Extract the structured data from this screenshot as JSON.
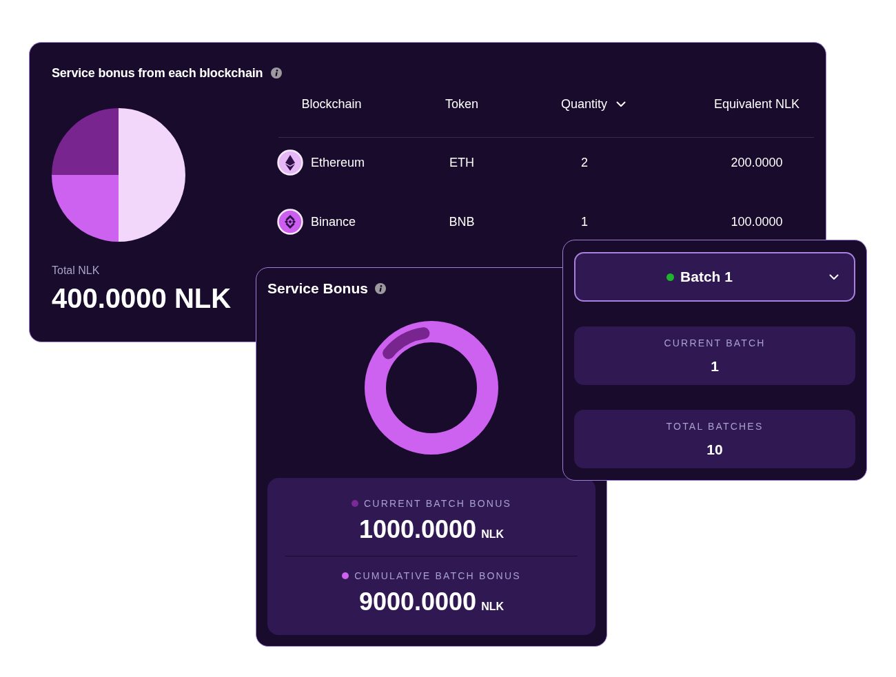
{
  "bonus_by_chain": {
    "title": "Service bonus from each blockchain",
    "chart_data": [
      {
        "type": "pie",
        "values": [
          50,
          25,
          25
        ],
        "colors": [
          "#f2d7fb",
          "#cd61f0",
          "#78258f"
        ]
      }
    ],
    "total_label": "Total NLK",
    "total_value": "400.0000 NLK",
    "table": {
      "columns": [
        {
          "label": "Blockchain",
          "sorted": false
        },
        {
          "label": "Token",
          "sorted": false
        },
        {
          "label": "Quantity",
          "sorted": true
        },
        {
          "label": "Equivalent NLK",
          "sorted": false
        }
      ],
      "rows": [
        {
          "kind": "ethereum",
          "blockchain": "Ethereum",
          "token": "ETH",
          "quantity": "2",
          "equivalent_nlk": "200.0000"
        },
        {
          "kind": "binance",
          "blockchain": "Binance",
          "token": "BNB",
          "quantity": "1",
          "equivalent_nlk": "100.0000"
        }
      ]
    }
  },
  "service_bonus": {
    "title": "Service Bonus",
    "progress_ring": {
      "level": 0.12
    },
    "stats": [
      {
        "label": "CURRENT BATCH BONUS",
        "value": "1000.0000",
        "unit": "NLK",
        "color": "#7a2a96"
      },
      {
        "label": "CUMULATIVE BATCH BONUS",
        "value": "9000.0000",
        "unit": "NLK",
        "color": "#cd61f0"
      }
    ]
  },
  "batch_panel": {
    "dropdown": {
      "label": "Batch 1",
      "color": "#1db32c"
    },
    "stats": [
      {
        "label": "CURRENT BATCH",
        "value": "1"
      },
      {
        "label": "TOTAL BATCHES",
        "value": "10"
      }
    ]
  }
}
